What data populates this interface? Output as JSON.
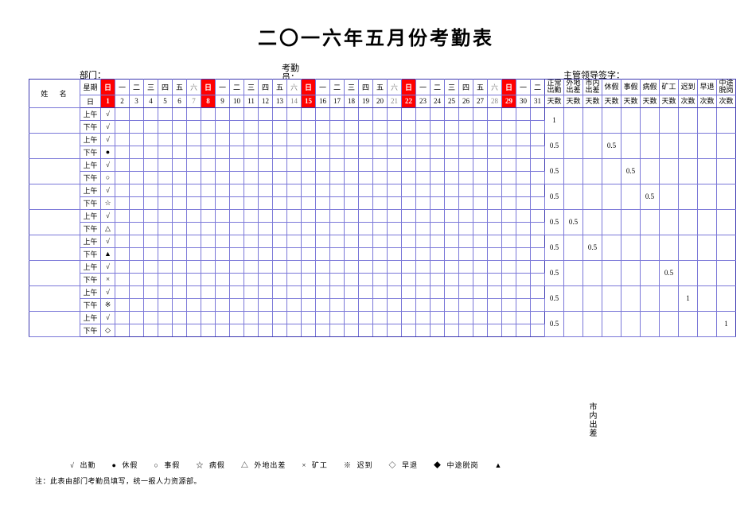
{
  "title": "二〇一六年五月份考勤表",
  "labels": {
    "department": "部门：",
    "clerk_line1": "考勤",
    "clerk_line2": "员：",
    "supervisor": "主管领导签字："
  },
  "header": {
    "name": "姓 名",
    "weekdays_label": "星期",
    "days_label": "日",
    "weekdays": [
      "日",
      "一",
      "二",
      "三",
      "四",
      "五",
      "六",
      "日",
      "一",
      "二",
      "三",
      "四",
      "五",
      "六",
      "日",
      "一",
      "二",
      "三",
      "四",
      "五",
      "六",
      "日",
      "一",
      "二",
      "三",
      "四",
      "五",
      "六",
      "日",
      "一",
      "二"
    ],
    "days": [
      "1",
      "2",
      "3",
      "4",
      "5",
      "6",
      "7",
      "8",
      "9",
      "10",
      "11",
      "12",
      "13",
      "14",
      "15",
      "16",
      "17",
      "18",
      "19",
      "20",
      "21",
      "22",
      "23",
      "24",
      "25",
      "26",
      "27",
      "28",
      "29",
      "30",
      "31"
    ],
    "red_cols": [
      0,
      7,
      14,
      21,
      28
    ],
    "sat_cols": [
      6,
      13,
      20,
      27
    ],
    "summary": [
      "正常\n出勤",
      "外地\n出差",
      "市内\n出差",
      "休假",
      "事假",
      "病假",
      "矿工",
      "迟到",
      "早退",
      "中途\n脱岗"
    ],
    "summary_sub": [
      "天数",
      "天数",
      "天数",
      "天数",
      "天数",
      "天数",
      "天数",
      "次数",
      "次数",
      "次数"
    ]
  },
  "ampm": {
    "am": "上午",
    "pm": "下午"
  },
  "rows": [
    {
      "am_mark": "√",
      "pm_mark": "√",
      "summary": [
        "1",
        "",
        "",
        "",
        "",
        "",
        "",
        "",
        "",
        ""
      ]
    },
    {
      "am_mark": "√",
      "pm_mark": "●",
      "summary": [
        "0.5",
        "",
        "",
        "0.5",
        "",
        "",
        "",
        "",
        "",
        ""
      ]
    },
    {
      "am_mark": "√",
      "pm_mark": "○",
      "summary": [
        "0.5",
        "",
        "",
        "",
        "0.5",
        "",
        "",
        "",
        "",
        ""
      ]
    },
    {
      "am_mark": "√",
      "pm_mark": "☆",
      "summary": [
        "0.5",
        "",
        "",
        "",
        "",
        "0.5",
        "",
        "",
        "",
        ""
      ]
    },
    {
      "am_mark": "√",
      "pm_mark": "△",
      "summary": [
        "0.5",
        "0.5",
        "",
        "",
        "",
        "",
        "",
        "",
        "",
        ""
      ]
    },
    {
      "am_mark": "√",
      "pm_mark": "▲",
      "summary": [
        "0.5",
        "",
        "0.5",
        "",
        "",
        "",
        "",
        "",
        "",
        ""
      ]
    },
    {
      "am_mark": "√",
      "pm_mark": "×",
      "summary": [
        "0.5",
        "",
        "",
        "",
        "",
        "",
        "0.5",
        "",
        "",
        ""
      ]
    },
    {
      "am_mark": "√",
      "pm_mark": "※",
      "summary": [
        "0.5",
        "",
        "",
        "",
        "",
        "",
        "",
        "1",
        "",
        ""
      ]
    },
    {
      "am_mark": "√",
      "pm_mark": "◇",
      "summary": [
        "0.5",
        "",
        "",
        "",
        "",
        "",
        "",
        "",
        "",
        "1"
      ]
    }
  ],
  "vert_label": "市内出差",
  "legend": [
    {
      "sym": "√",
      "txt": "出勤"
    },
    {
      "sym": "●",
      "txt": "休假"
    },
    {
      "sym": "○",
      "txt": "事假"
    },
    {
      "sym": "☆",
      "txt": "病假"
    },
    {
      "sym": "△",
      "txt": "外地出差"
    },
    {
      "sym": "×",
      "txt": "矿工"
    },
    {
      "sym": "※",
      "txt": "迟到"
    },
    {
      "sym": "◇",
      "txt": "早退"
    },
    {
      "sym": "◆",
      "txt": "中途脱岗"
    },
    {
      "sym": "▲",
      "txt": ""
    }
  ],
  "footnote": "注：此表由部门考勤员填写，统一报人力资源部。"
}
